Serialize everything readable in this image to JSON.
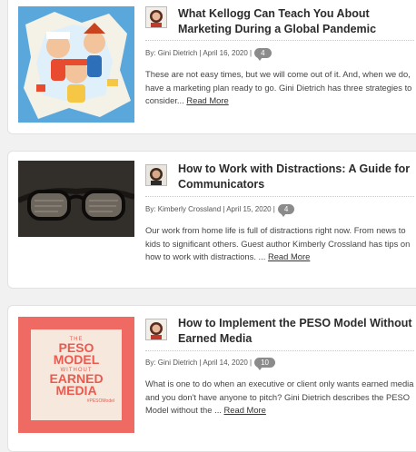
{
  "posts": [
    {
      "title": "What Kellogg Can Teach You About Marketing During a Global Pandemic",
      "meta": "By: Gini Dietrich | April 16, 2020 |",
      "comments": "4",
      "excerpt": "These are not easy times, but we will come out of it. And, when we do, have a marketing plan ready to go. Gini Dietrich has three strategies to consider...",
      "read_more": "Read More"
    },
    {
      "title": "How to Work with Distractions: A Guide for Communicators",
      "meta": "By: Kimberly Crossland | April 15, 2020 |",
      "comments": "4",
      "excerpt": "Our work from home life is full of distractions right now. From news to kids to significant others. Guest author Kimberly Crossland has tips on how to work with distractions. ...",
      "read_more": "Read More"
    },
    {
      "title": "How to Implement the PESO Model Without Earned Media",
      "meta": "By: Gini Dietrich | April 14, 2020 |",
      "comments": "10",
      "excerpt": "What is one to do when an executive or client only wants earned media and you don't have anyone to pitch? Gini Dietrich describes the PESO Model without the ...",
      "read_more": "Read More"
    }
  ],
  "peso_image": {
    "line1": "THE",
    "line2": "PESO",
    "line3": "MODEL",
    "line4": "WITHOUT",
    "line5": "EARNED",
    "line6": "MEDIA",
    "tag": "#PESOModel"
  }
}
